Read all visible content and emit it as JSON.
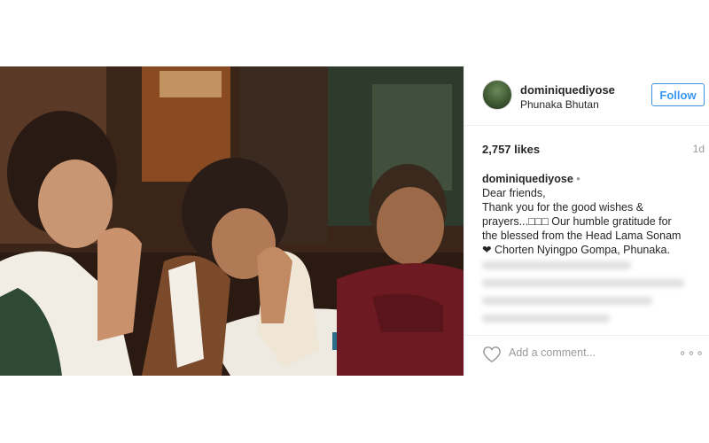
{
  "post": {
    "photo_alt": "",
    "header": {
      "username": "dominiquediyose",
      "location": "Phunaka Bhutan",
      "follow_label": "Follow"
    },
    "likes": "2,757 likes",
    "age": "1d",
    "caption": {
      "username": "dominiquediyose",
      "dot": "•",
      "lines": [
        "Dear friends,",
        "Thank you for the good wishes &",
        "prayers...□□□ Our humble gratitude for",
        "the blessed from the Head Lama Sonam",
        "❤ Chorten Nyingpo Gompa, Phunaka."
      ]
    },
    "comment_placeholder": "Add a comment...",
    "more_label": "∘∘∘"
  },
  "colors": {
    "accent": "#3897f0",
    "text": "#262626",
    "muted": "#999999",
    "border": "#efefef"
  },
  "icons": {
    "like": "heart-outline-icon",
    "more": "more-options-icon"
  }
}
